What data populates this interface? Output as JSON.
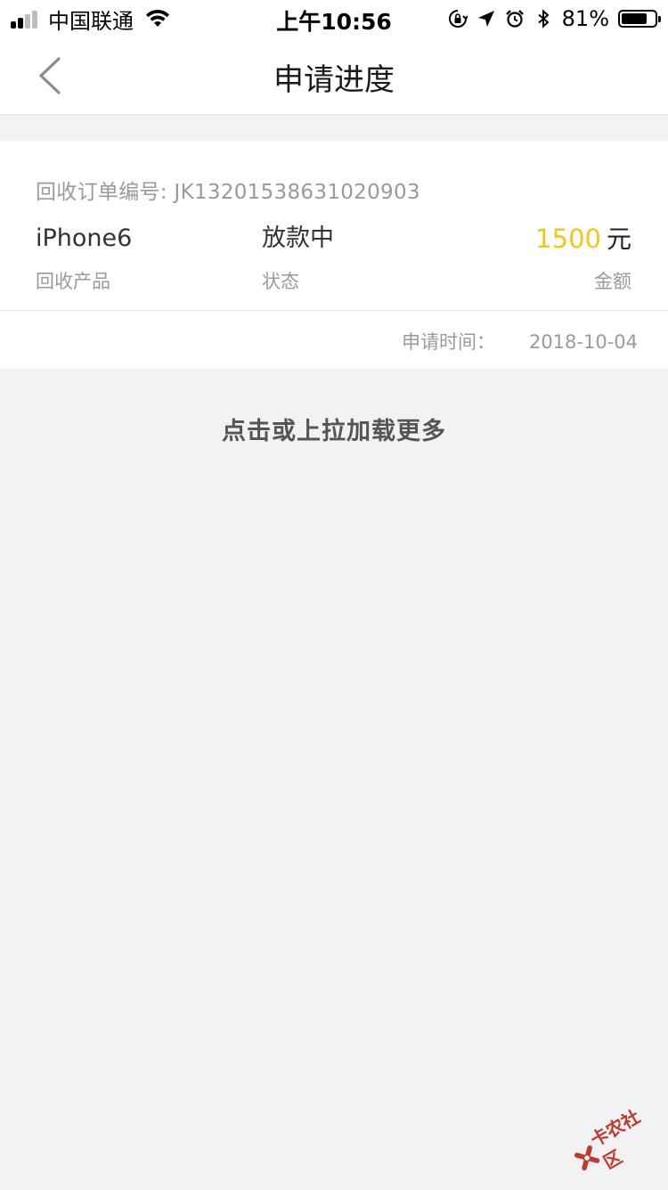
{
  "status_bar": {
    "carrier": "中国联通",
    "time": "上午10:56",
    "battery_percent": "81%",
    "battery_level": 0.81,
    "icons": [
      "signal-icon",
      "wifi-icon",
      "orientation-lock-icon",
      "location-icon",
      "alarm-icon",
      "bluetooth-icon",
      "battery-icon"
    ]
  },
  "nav": {
    "title": "申请进度",
    "back_icon": "chevron-left-icon"
  },
  "order": {
    "number_label": "回收订单编号:",
    "number_value": "JK13201538631020903",
    "product": {
      "value": "iPhone6",
      "label": "回收产品"
    },
    "status": {
      "value": "放款中",
      "label": "状态"
    },
    "amount": {
      "value": "1500",
      "unit": "元",
      "label": "金额"
    },
    "apply_time_label": "申请时间：",
    "apply_time_value": "2018-10-04"
  },
  "load_more": "点击或上拉加载更多",
  "watermark": {
    "text": "卡农社区"
  },
  "colors": {
    "amount": "#f5c518",
    "background": "#f2f2f2",
    "card": "#ffffff",
    "secondary_text": "#9a9a9a"
  }
}
